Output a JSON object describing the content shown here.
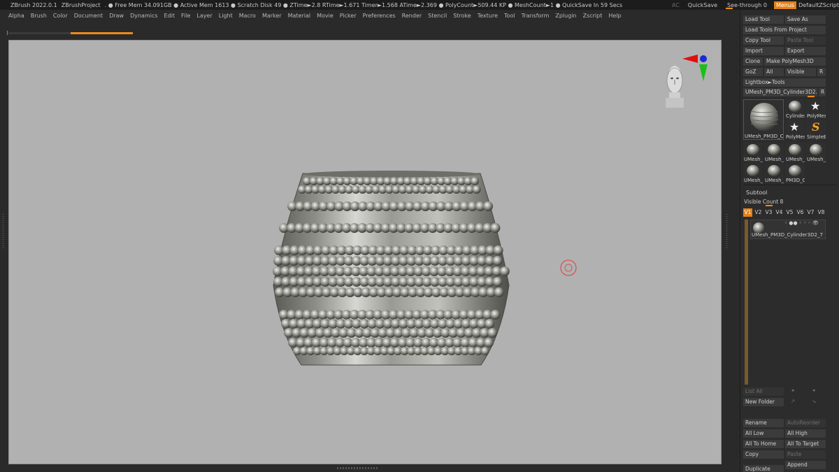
{
  "titlebar": {
    "app": "ZBrush 2022.0.1",
    "project": "ZBrushProject",
    "stats": ". ● Free Mem 34.091GB ● Active Mem 1613 ● Scratch Disk 49 ● ZTime►2.8 RTime►1.671 Timer►1.568 ATime►2.369 ● PolyCount►509.44 KP ● MeshCount►1 ● QuickSave In 59 Secs",
    "ac": "AC",
    "quicksave": "QuickSave",
    "seethrough": "See-through",
    "seethrough_value": "0",
    "menus": "Menus",
    "zscript": "DefaultZScript"
  },
  "menubar": [
    "Alpha",
    "Brush",
    "Color",
    "Document",
    "Draw",
    "Dynamics",
    "Edit",
    "File",
    "Layer",
    "Light",
    "Macro",
    "Marker",
    "Material",
    "Movie",
    "Picker",
    "Preferences",
    "Render",
    "Stencil",
    "Stroke",
    "Texture",
    "Tool",
    "Transform",
    "Zplugin",
    "Zscript",
    "Help"
  ],
  "tool_palette": {
    "load_tool": "Load Tool",
    "save_as": "Save As",
    "load_from_project": "Load Tools From Project",
    "copy_tool": "Copy Tool",
    "paste_tool": "Paste Tool",
    "import": "Import",
    "export": "Export",
    "clone": "Clone",
    "make_polymesh": "Make PolyMesh3D",
    "goz": "GoZ",
    "all": "All",
    "visible": "Visible",
    "r": "R",
    "lightbox": "Lightbox►Tools",
    "current_tool": "UMesh_PM3D_Cylinder3D2. 5",
    "current_tool_r": "R",
    "main_thumb_label": "UMesh_PM3D_C",
    "thumbs": [
      "Cylinder",
      "PolyMes",
      "PolyMes",
      "SimpleB",
      "UMesh_",
      "UMesh_",
      "UMesh_",
      "UMesh_",
      "UMesh_",
      "UMesh_",
      "PM3D_C"
    ]
  },
  "subtool": {
    "title": "Subtool",
    "visible_count": "Visible Count 8",
    "versions": [
      "V1",
      "V2",
      "V3",
      "V4",
      "V5",
      "V6",
      "V7",
      "V8"
    ],
    "item_name": "UMesh_PM3D_Cylinder3D2_7",
    "list_all": "List All",
    "new_folder": "New Folder",
    "rename": "Rename",
    "autoreorder": "AutoReorder",
    "all_low": "All Low",
    "all_high": "All High",
    "all_to_home": "All To Home",
    "all_to_target": "All To Target",
    "copy": "Copy",
    "paste": "Paste",
    "duplicate": "Duplicate",
    "append": "Append"
  },
  "colors": {
    "accent": "#f08a1c",
    "canvas": "#b1b1b1",
    "panel": "#2c2c2c"
  }
}
